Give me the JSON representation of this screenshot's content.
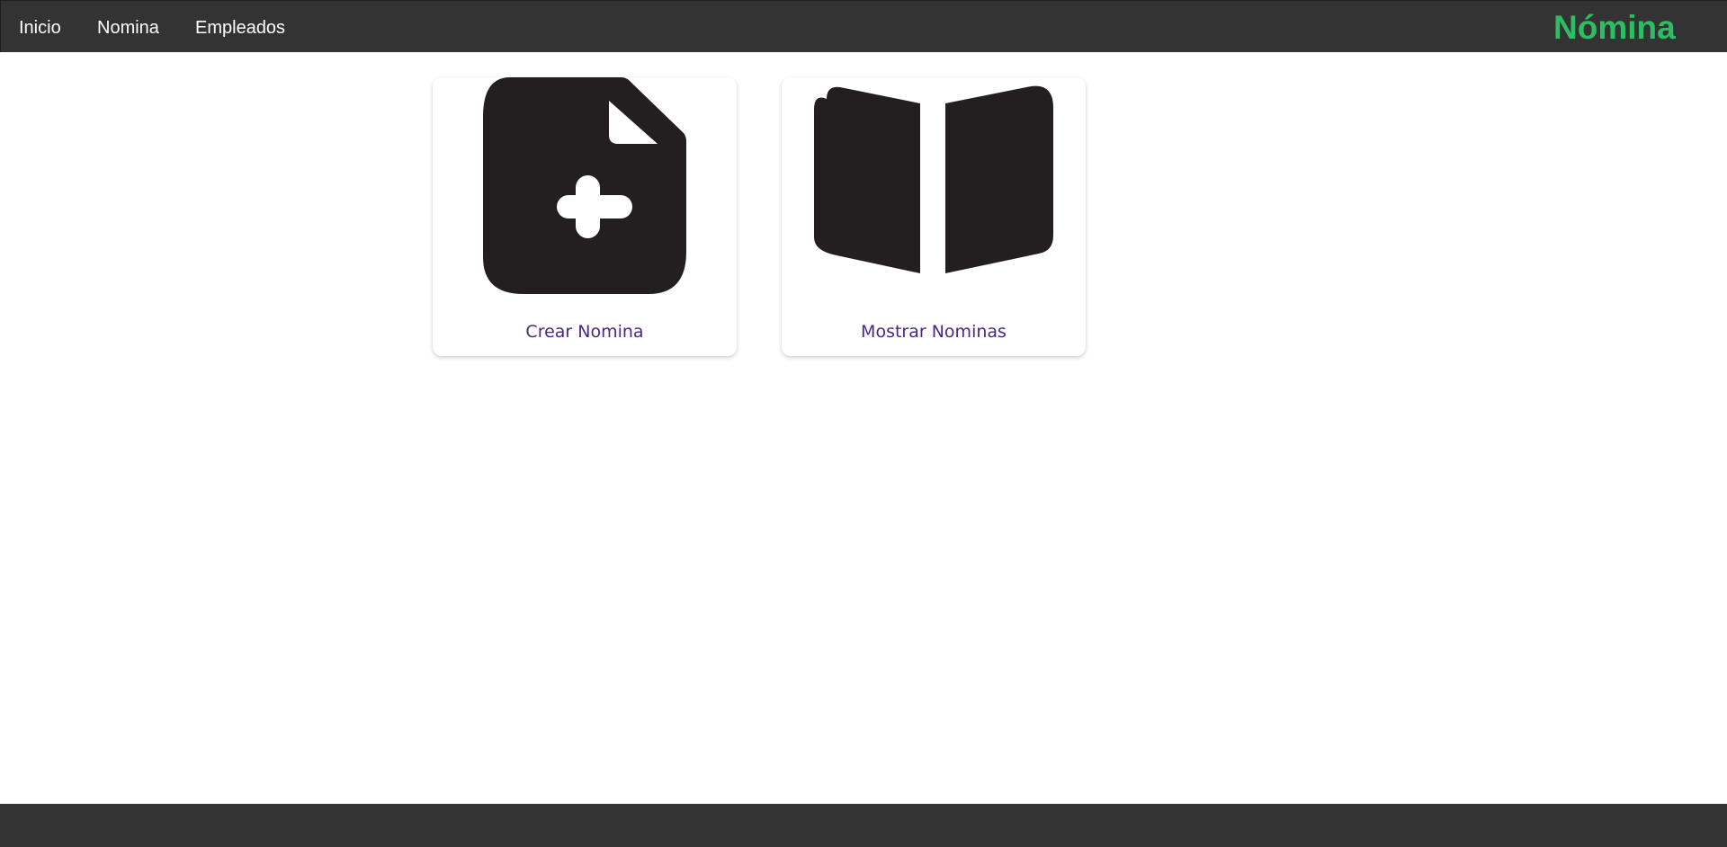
{
  "navbar": {
    "links": [
      {
        "label": "Inicio"
      },
      {
        "label": "Nomina"
      },
      {
        "label": "Empleados"
      }
    ],
    "brand": "Nómina",
    "brand_color": "#2dbd63",
    "background_color": "#333333"
  },
  "cards": [
    {
      "label": "Crear Nomina",
      "icon": "file-plus-icon"
    },
    {
      "label": "Mostrar Nominas",
      "icon": "open-book-icon"
    }
  ],
  "colors": {
    "card_label": "#4b2785",
    "icon": "#231f20",
    "footer": "#333333"
  }
}
